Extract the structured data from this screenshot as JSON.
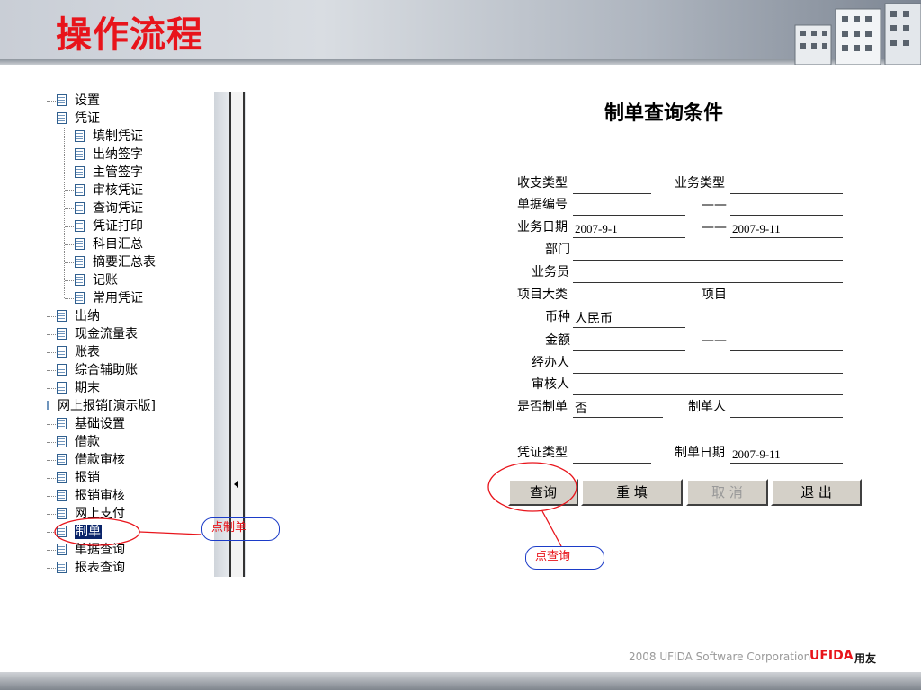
{
  "header": {
    "title": "操作流程"
  },
  "tree": {
    "items": [
      {
        "label": "设置"
      },
      {
        "label": "凭证"
      },
      {
        "label": "填制凭证"
      },
      {
        "label": "出纳签字"
      },
      {
        "label": "主管签字"
      },
      {
        "label": "审核凭证"
      },
      {
        "label": "查询凭证"
      },
      {
        "label": "凭证打印"
      },
      {
        "label": "科目汇总"
      },
      {
        "label": "摘要汇总表"
      },
      {
        "label": "记账"
      },
      {
        "label": "常用凭证"
      },
      {
        "label": "出纳"
      },
      {
        "label": "现金流量表"
      },
      {
        "label": "账表"
      },
      {
        "label": "综合辅助账"
      },
      {
        "label": "期末"
      },
      {
        "label": "网上报销[演示版]"
      },
      {
        "label": "基础设置"
      },
      {
        "label": "借款"
      },
      {
        "label": "借款审核"
      },
      {
        "label": "报销"
      },
      {
        "label": "报销审核"
      },
      {
        "label": "网上支付"
      },
      {
        "label": "制单"
      },
      {
        "label": "单据查询"
      },
      {
        "label": "报表查询"
      }
    ]
  },
  "form": {
    "title": "制单查询条件",
    "labels": {
      "income_type": "收支类型",
      "business_type": "业务类型",
      "doc_no": "单据编号",
      "business_date": "业务日期",
      "department": "部门",
      "salesperson": "业务员",
      "project_category": "项目大类",
      "project": "项目",
      "currency": "币种",
      "amount": "金额",
      "handler": "经办人",
      "reviewer": "审核人",
      "made": "是否制单",
      "maker": "制单人",
      "voucher_type": "凭证类型",
      "make_date": "制单日期"
    },
    "range_dash": "——",
    "values": {
      "date_from": "2007-9-1",
      "date_to": "2007-9-11",
      "currency": "人民币",
      "made": "否",
      "make_date": "2007-9-11"
    },
    "buttons": {
      "query": "查询",
      "reset": "重 填",
      "cancel": "取 消",
      "exit": "退 出"
    }
  },
  "annotations": {
    "click_make": "点制单",
    "click_query": "点查询"
  },
  "footer": {
    "copyright": "2008 UFIDA Software Corporation",
    "logo": "UFIDA",
    "logo_cn": "用友"
  },
  "colors": {
    "title_red": "#e8141b",
    "annotation_blue": "#1c3cc8",
    "selection": "#0a246a"
  }
}
